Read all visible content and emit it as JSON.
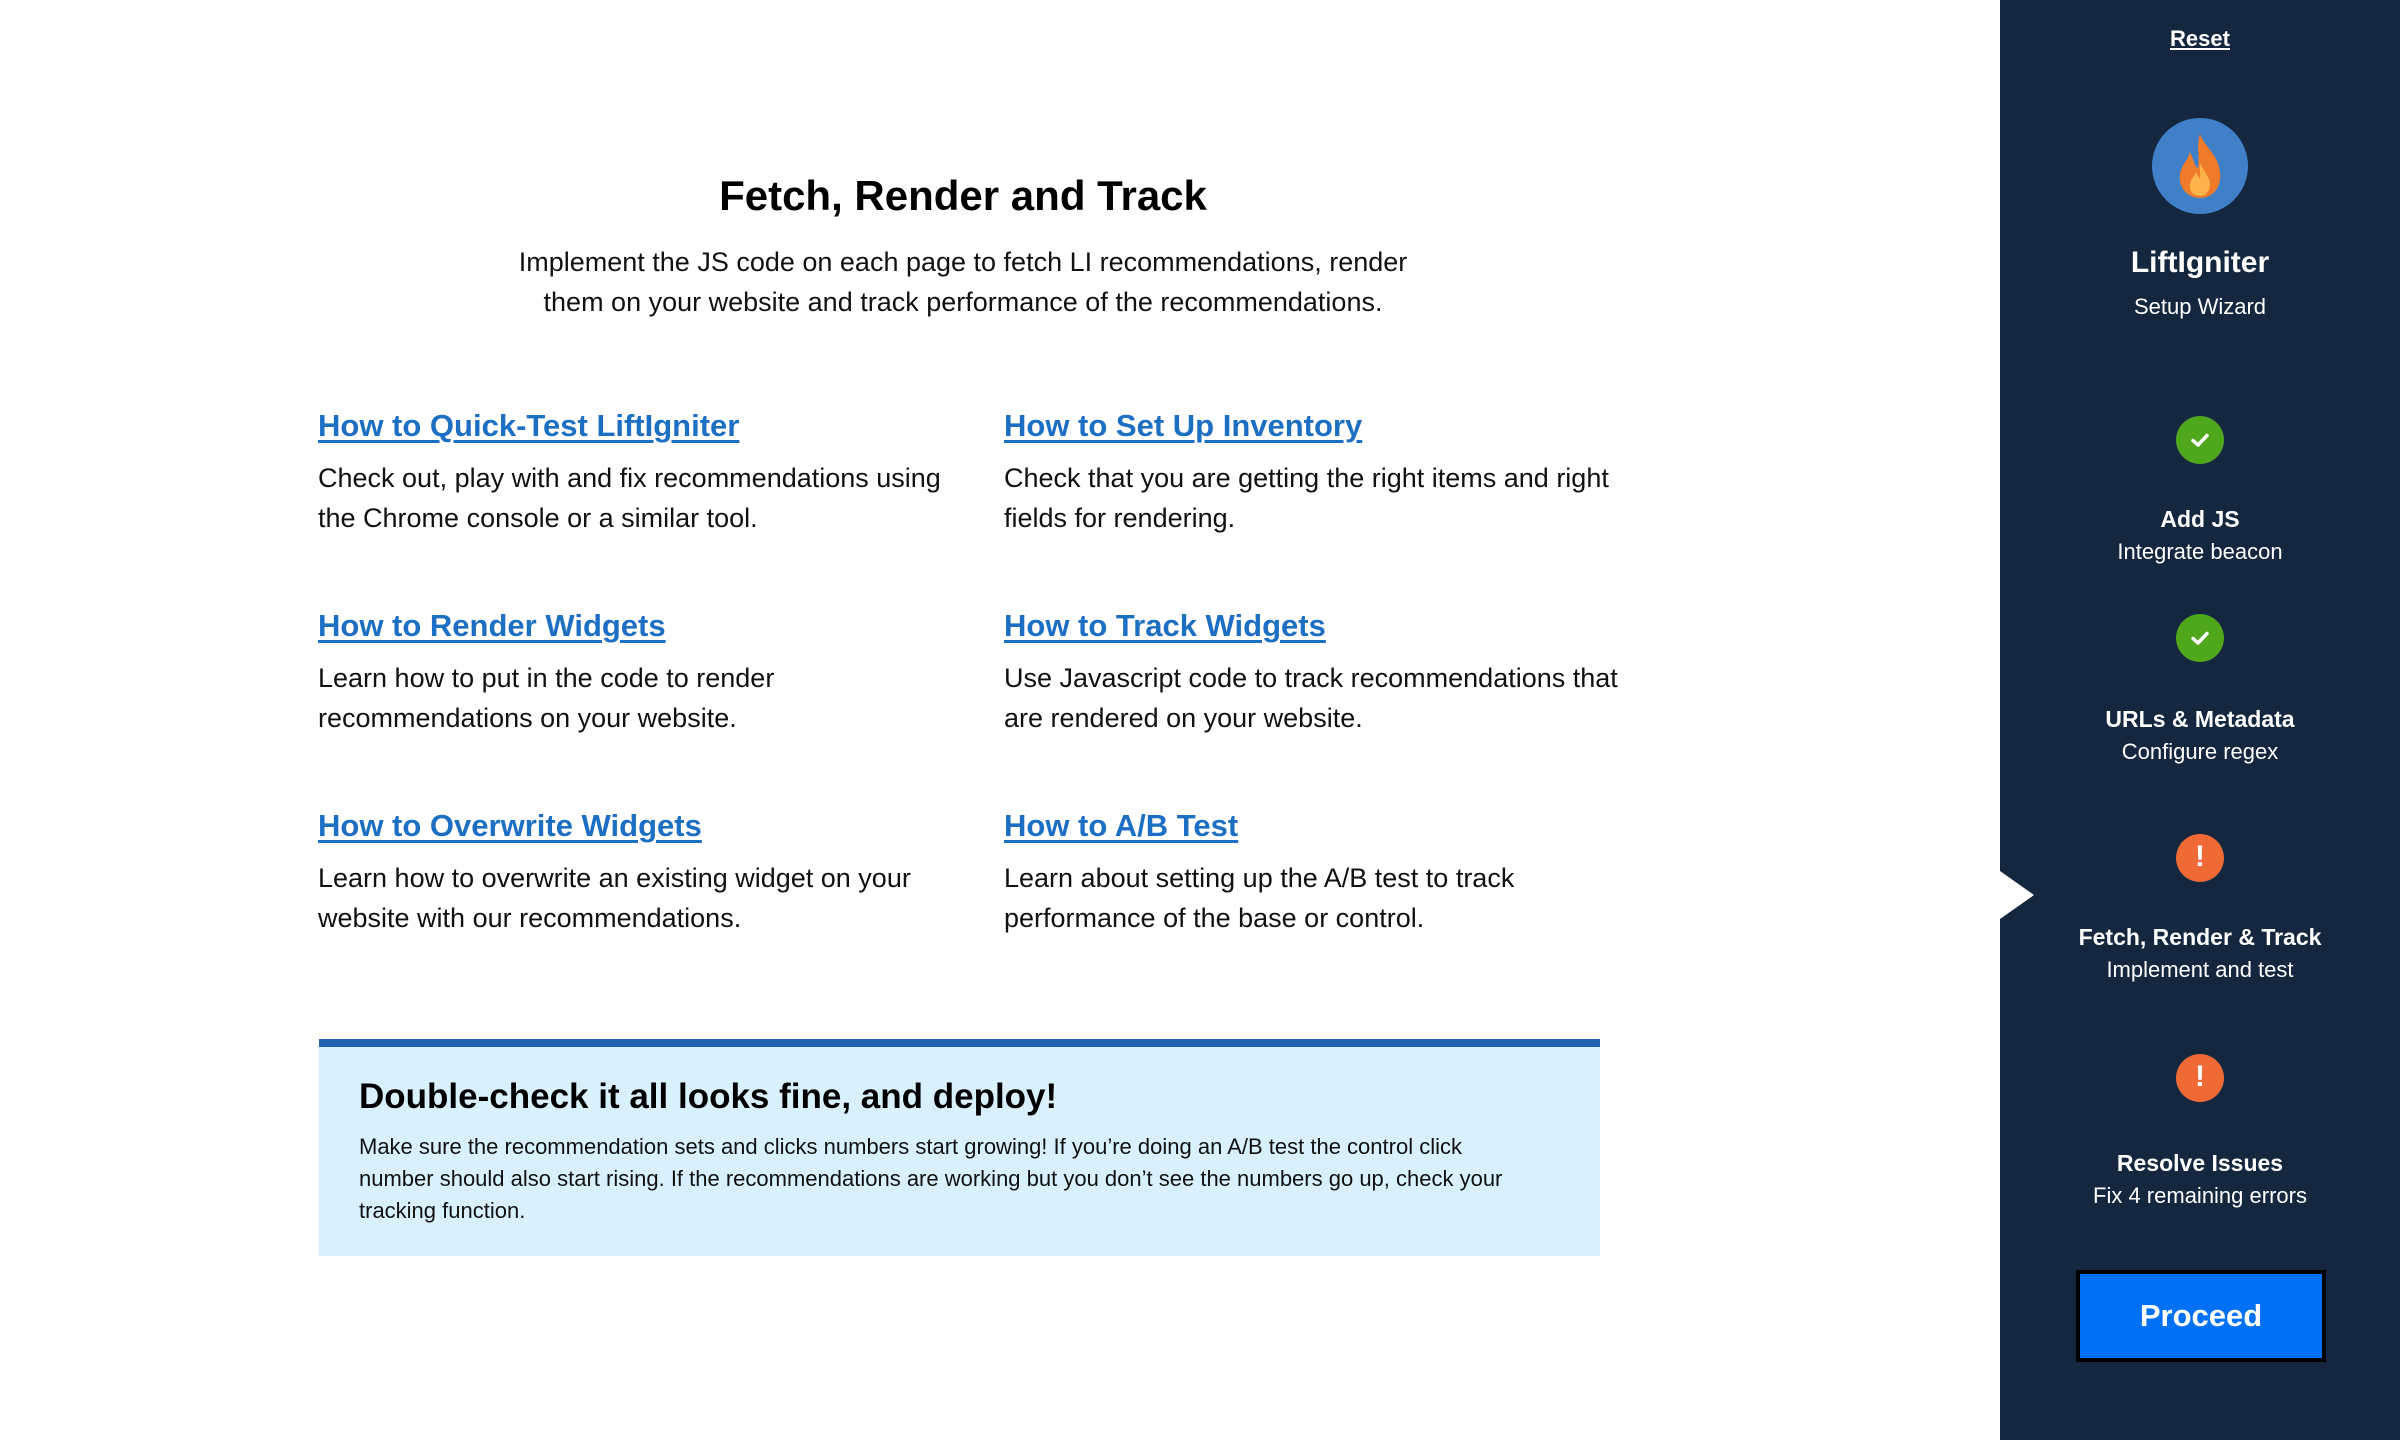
{
  "main": {
    "title": "Fetch, Render and Track",
    "subtitle": "Implement the JS code on each page to fetch LI recommendations, render them on your website and track performance of the recommendations.",
    "guides": [
      {
        "link": "How to Quick-Test LiftIgniter",
        "desc": "Check out, play with and fix recommendations using the Chrome console or a similar tool."
      },
      {
        "link": "How to Set Up Inventory",
        "desc": "Check that you are getting the right items and right fields for rendering."
      },
      {
        "link": "How to Render Widgets",
        "desc": "Learn how to put in the code to render recommendations on your website."
      },
      {
        "link": "How to Track Widgets",
        "desc": "Use Javascript code to track recommendations that are rendered on your website."
      },
      {
        "link": "How to Overwrite Widgets",
        "desc": "Learn how to overwrite an existing widget on your website with our recommendations."
      },
      {
        "link": "How to A/B Test",
        "desc": "Learn about setting up the A/B test to track performance of the base or control."
      }
    ],
    "deploy": {
      "title": "Double-check it all looks fine, and deploy!",
      "text": "Make sure the recommendation sets and clicks numbers start growing! If you’re doing an A/B test the control click number should also start rising. If the recommendations are working but you don’t see the numbers go up, check your tracking function."
    }
  },
  "sidebar": {
    "reset_label": "Reset",
    "brand_name": "LiftIgniter",
    "brand_sub": "Setup Wizard",
    "logo_icon": "flame-icon",
    "steps": [
      {
        "title": "Add JS",
        "sub": "Integrate beacon",
        "status": "done",
        "icon": "checkmark-icon"
      },
      {
        "title": "URLs & Metadata",
        "sub": "Configure regex",
        "status": "done",
        "icon": "checkmark-icon"
      },
      {
        "title": "Fetch, Render & Track",
        "sub": "Implement and test",
        "status": "warning",
        "icon": "exclamation-icon",
        "active": true
      },
      {
        "title": "Resolve Issues",
        "sub": "Fix 4 remaining errors",
        "status": "warning",
        "icon": "exclamation-icon"
      }
    ],
    "proceed_label": "Proceed"
  },
  "colors": {
    "link": "#1d6fc4",
    "sidebar_bg": "#14273f",
    "deploy_bg": "#d9f1fd",
    "deploy_border": "#2163b0",
    "done": "#4fa81c",
    "warning": "#f06a35",
    "proceed_bg": "#0070f5",
    "logo_bg": "#3f80c8"
  }
}
